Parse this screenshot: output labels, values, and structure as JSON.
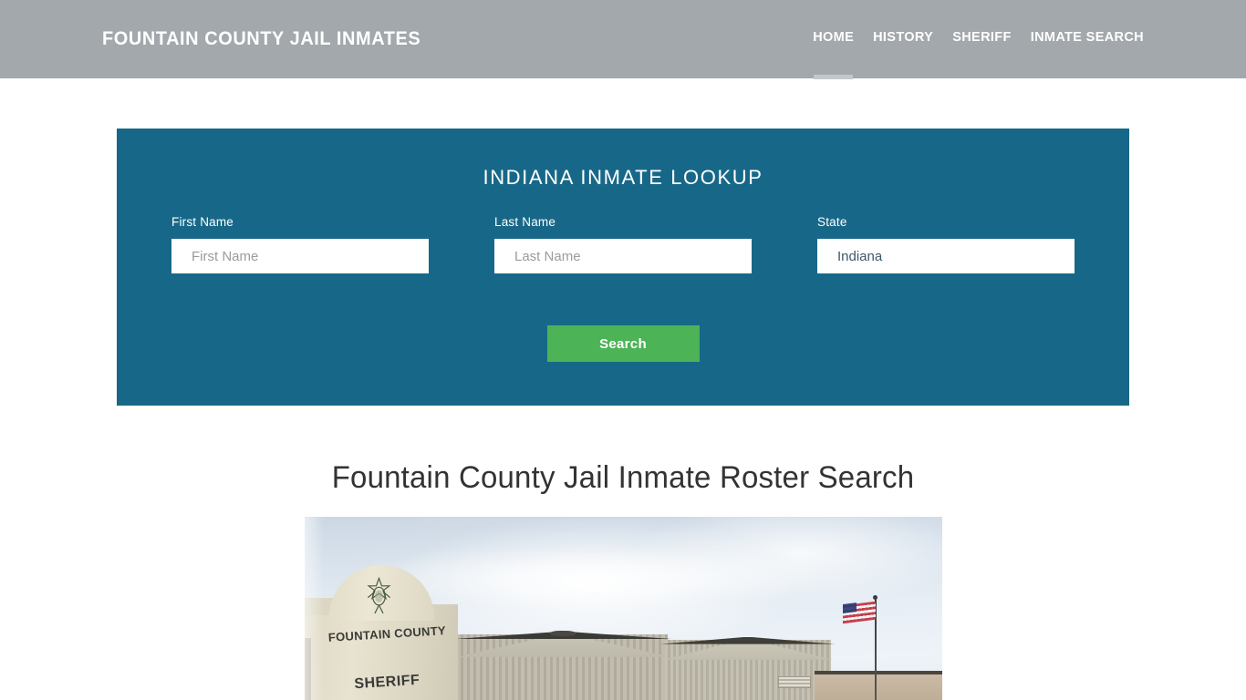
{
  "header": {
    "brand": "FOUNTAIN COUNTY JAIL INMATES",
    "nav": [
      {
        "label": "HOME",
        "active": true
      },
      {
        "label": "HISTORY",
        "active": false
      },
      {
        "label": "SHERIFF",
        "active": false
      },
      {
        "label": "INMATE SEARCH",
        "active": false
      }
    ],
    "background_color": "#a2a8ac",
    "active_indicator_color": "#c3c8cb"
  },
  "lookup": {
    "title": "INDIANA INMATE LOOKUP",
    "panel_color": "#176888",
    "fields": {
      "first_name": {
        "label": "First Name",
        "placeholder": "First Name",
        "value": ""
      },
      "last_name": {
        "label": "Last Name",
        "placeholder": "Last Name",
        "value": ""
      },
      "state": {
        "label": "State",
        "value": "Indiana",
        "options": [
          "Indiana"
        ]
      }
    },
    "search_button": {
      "label": "Search",
      "color": "#4cb356"
    }
  },
  "content": {
    "heading": "Fountain County Jail Inmate Roster Search",
    "photo": {
      "alt": "Fountain County Sheriff building exterior with monument sign and United States flag",
      "sign_line_1": "FOUNTAIN COUNTY",
      "sign_line_2": "SHERIFF"
    }
  }
}
